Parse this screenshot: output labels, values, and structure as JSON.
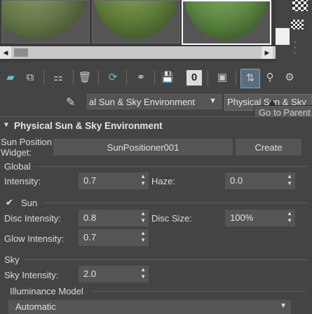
{
  "slots": {
    "items": [
      {
        "name": "material-slot-1"
      },
      {
        "name": "material-slot-2"
      },
      {
        "name": "material-slot-3"
      }
    ]
  },
  "scroll": {
    "left_arrow": "◀",
    "right_arrow": "▶"
  },
  "toolbar": {
    "icons": [
      "get-material-icon",
      "put-to-scene-icon",
      "assign-to-selection-icon",
      "delete-icon",
      "make-unique-icon",
      "put-to-library-icon",
      "save-icon",
      "material-id-channel-icon",
      "show-shaded-icon",
      "go-to-parent-icon",
      "go-forward-icon",
      "select-by-material-icon"
    ],
    "material_id": "0"
  },
  "name_row": {
    "dropdown_value": "al Sun & Sky Environment",
    "dropdown_arrow": "▼",
    "type_button": "Physical Sun & Sky",
    "tooltip": "Go to Parent"
  },
  "rollout": {
    "title": "Physical Sun & Sky Environment",
    "collapse_glyph": "▼",
    "sun_position_label": "Sun Position\nWidget:",
    "sun_position_line1": "Sun Position",
    "sun_position_line2": "Widget:",
    "sun_positioner_button": "SunPositioner001",
    "create_button": "Create",
    "global": {
      "group_label": "Global",
      "intensity_label": "Intensity:",
      "intensity_value": "0.7",
      "haze_label": "Haze:",
      "haze_value": "0.0"
    },
    "sun": {
      "group_label": "Sun",
      "checked": true,
      "check_glyph": "✔",
      "disc_intensity_label": "Disc Intensity:",
      "disc_intensity_value": "0.8",
      "disc_size_label": "Disc Size:",
      "disc_size_value": "100%",
      "glow_intensity_label": "Glow Intensity:",
      "glow_intensity_value": "0.7"
    },
    "sky": {
      "group_label": "Sky",
      "sky_intensity_label": "Sky Intensity:",
      "sky_intensity_value": "2.0",
      "illuminance_model_label": "Illuminance Model",
      "illuminance_model_value": "Automatic"
    }
  },
  "colors": {
    "background": "#444444",
    "field": "#555555",
    "active_tool": "#5a6e80"
  }
}
